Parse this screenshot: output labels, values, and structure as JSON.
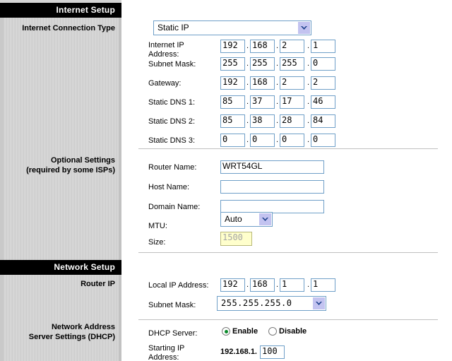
{
  "sections": {
    "internet_setup": {
      "bar_title": "Internet Setup",
      "conn_type_label": "Internet Connection Type",
      "conn_type_value": "Static IP",
      "fields": {
        "internet_ip_label": "Internet IP\nAddress:",
        "internet_ip": [
          "192",
          "168",
          "2",
          "1"
        ],
        "subnet_mask_label": "Subnet Mask:",
        "subnet_mask": [
          "255",
          "255",
          "255",
          "0"
        ],
        "gateway_label": "Gateway:",
        "gateway": [
          "192",
          "168",
          "2",
          "2"
        ],
        "dns1_label": "Static DNS 1:",
        "dns1": [
          "85",
          "37",
          "17",
          "46"
        ],
        "dns2_label": "Static DNS 2:",
        "dns2": [
          "85",
          "38",
          "28",
          "84"
        ],
        "dns3_label": "Static DNS 3:",
        "dns3": [
          "0",
          "0",
          "0",
          "0"
        ]
      }
    },
    "optional_settings": {
      "side_label_line1": "Optional Settings",
      "side_label_line2": "(required by some ISPs)",
      "router_name_label": "Router Name:",
      "router_name_value": "WRT54GL",
      "host_name_label": "Host Name:",
      "host_name_value": "",
      "domain_name_label": "Domain Name:",
      "domain_name_value": "",
      "mtu_label": "MTU:",
      "mtu_value": "Auto",
      "size_label": "Size:",
      "size_value": "1500"
    },
    "network_setup": {
      "bar_title": "Network Setup",
      "router_ip_label": "Router IP",
      "local_ip_label": "Local IP Address:",
      "local_ip": [
        "192",
        "168",
        "1",
        "1"
      ],
      "lan_subnet_label": "Subnet Mask:",
      "lan_subnet_value": "255.255.255.0"
    },
    "dhcp": {
      "side_label_line1": "Network Address",
      "side_label_line2": "Server Settings (DHCP)",
      "dhcp_server_label": "DHCP Server:",
      "enable_label": "Enable",
      "disable_label": "Disable",
      "dhcp_selected": "Enable",
      "starting_ip_label": "Starting IP\nAddress:",
      "starting_ip_prefix": "192.168.1.",
      "starting_ip_value": "100"
    }
  },
  "icons": {
    "dropdown_arrow": "chevron-down-icon"
  },
  "colors": {
    "bar_background": "#000000",
    "bar_text": "#ffffff",
    "sidebar_background": "#d3d3d3",
    "input_border": "#6f9fc8",
    "disabled_field_background": "#ffffcc",
    "disabled_field_text": "#a6a6a6",
    "dropdown_arrow_background": "#c3c3f0",
    "radio_selected": "#0a8a2a",
    "divider": "#c0c0c0"
  },
  "dot_separator": "."
}
